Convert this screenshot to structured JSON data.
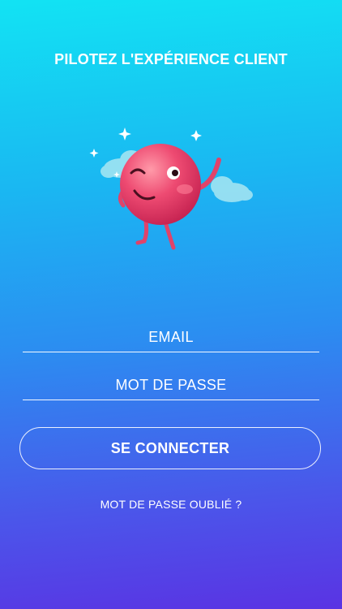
{
  "header": {
    "title": "PILOTEZ L'EXPÉRIENCE CLIENT"
  },
  "mascot": {
    "icon": "winking-pink-ball-mascot-icon",
    "color": "#e8416a"
  },
  "form": {
    "email_placeholder": "EMAIL",
    "password_placeholder": "MOT DE PASSE",
    "submit_label": "SE CONNECTER",
    "forgot_label": "MOT DE PASSE OUBLIÉ ?"
  },
  "colors": {
    "gradient_top": "#12e3f3",
    "gradient_bottom": "#5a33e3",
    "text": "#ffffff"
  }
}
